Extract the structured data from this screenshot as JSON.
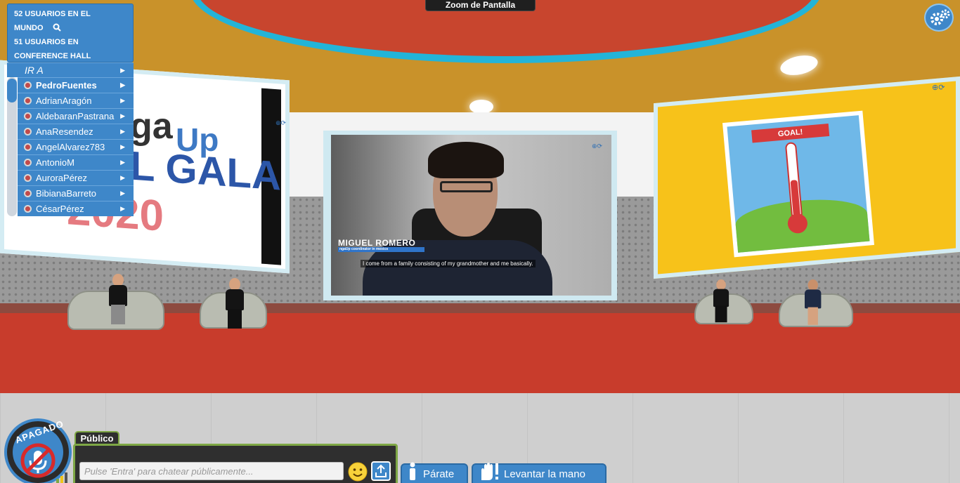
{
  "header": {
    "users_world": "52 USUARIOS EN EL MUNDO",
    "users_room": "51 USUARIOS EN CONFERENCE HALL",
    "zoom_label": "Zoom de Pantalla"
  },
  "nav": {
    "go_to_label": "IR A",
    "users": [
      {
        "name": "PedroFuentes"
      },
      {
        "name": "AdrianAragón"
      },
      {
        "name": "AldebaranPastrana"
      },
      {
        "name": "AnaResendez"
      },
      {
        "name": "AngelAlvarez783"
      },
      {
        "name": "AntonioM"
      },
      {
        "name": "AuroraPérez"
      },
      {
        "name": "BibianaBarreto"
      },
      {
        "name": "CésarPérez"
      }
    ]
  },
  "scene": {
    "left_screen_lines": [
      "ga",
      "Up",
      "L GALA",
      "2020"
    ],
    "video_speaker_name": "MIGUEL ROMERO",
    "video_speaker_role": "ngaUp coordinator in mexico",
    "video_caption": "I come from a family consisting of my grandmother and me basically.",
    "goal_banner": "GOAL!"
  },
  "bottom": {
    "mic_status": "APAGADO",
    "chat_tab": "Público",
    "chat_placeholder": "Pulse 'Entra' para chatear públicamente...",
    "stand_label": "Párate",
    "raise_hand_label": "Levantar la mano"
  },
  "colors": {
    "accent": "#3e87c9",
    "chat_border": "#7ea745",
    "carpet": "#c83c2c"
  },
  "icons": [
    "search-icon",
    "chevron-right-icon",
    "user-status-icon",
    "gear-icon",
    "mic-muted-icon",
    "signal-icon",
    "smiley-icon",
    "upload-icon",
    "standing-person-icon",
    "raised-hand-icon",
    "screen-zoom-icon",
    "screen-refresh-icon"
  ]
}
